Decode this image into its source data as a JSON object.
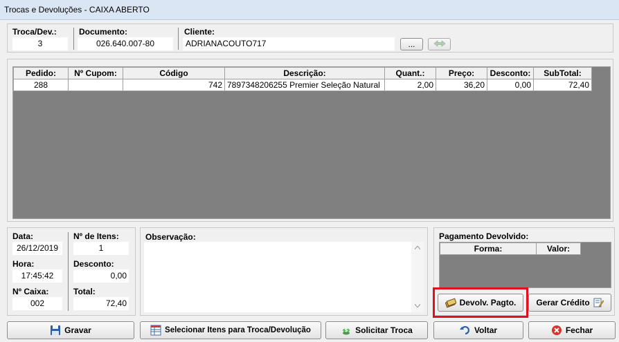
{
  "window": {
    "title": "Trocas e Devoluções - CAIXA ABERTO"
  },
  "header": {
    "troca_label": "Troca/Dev.:",
    "troca_value": "3",
    "documento_label": "Documento:",
    "documento_value": "026.640.007-80",
    "cliente_label": "Cliente:",
    "cliente_value": "ADRIANACOUTO717",
    "browse_label": "..."
  },
  "items_grid": {
    "columns": [
      "Pedido:",
      "Nº Cupom:",
      "Código",
      "Descrição:",
      "Quant.:",
      "Preço:",
      "Desconto:",
      "SubTotal:"
    ],
    "rows": [
      {
        "pedido": "288",
        "cupom": "",
        "codigo": "742",
        "descricao": "7897348206255 Premier Seleção Natural",
        "quant": "2,00",
        "preco": "36,20",
        "desconto": "0,00",
        "subtotal": "72,40"
      }
    ]
  },
  "info": {
    "data_label": "Data:",
    "data_value": "26/12/2019",
    "hora_label": "Hora:",
    "hora_value": "17:45:42",
    "caixa_label": "Nº Caixa:",
    "caixa_value": "002",
    "itens_label": "Nº de Itens:",
    "itens_value": "1",
    "desconto_label": "Desconto:",
    "desconto_value": "0,00",
    "total_label": "Total:",
    "total_value": "72,40"
  },
  "observacao": {
    "label": "Observação:",
    "value": ""
  },
  "pagamento": {
    "label": "Pagamento Devolvido:",
    "columns": [
      "Forma:",
      "Valor:"
    ],
    "devolv_button": "Devolv. Pagto.",
    "credito_button": "Gerar Crédito"
  },
  "footer": {
    "gravar": "Gravar",
    "selecionar": "Selecionar Itens para Troca/Devolução",
    "solicitar": "Solicitar Troca",
    "voltar": "Voltar",
    "fechar": "Fechar"
  },
  "colors": {
    "highlight": "#e0101e",
    "grid_background": "#808080"
  }
}
